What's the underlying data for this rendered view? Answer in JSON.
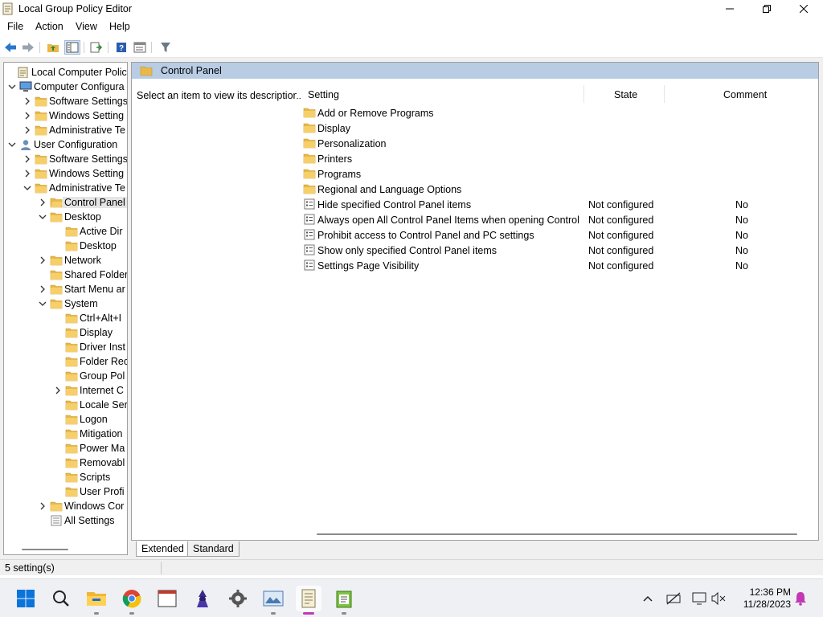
{
  "window": {
    "title": "Local Group Policy Editor",
    "controls": {
      "minimize": "—",
      "maximize": "❐",
      "close": "✕"
    }
  },
  "menu": [
    "File",
    "Action",
    "View",
    "Help"
  ],
  "toolbar": [
    "back-icon",
    "forward-icon",
    "up-folder-icon",
    "show-hide-tree-icon",
    "export-list-icon",
    "help-icon",
    "properties-icon",
    "filter-icon"
  ],
  "tree": [
    {
      "label": "Local Computer Policy",
      "icon": "computer-policy-icon",
      "level": 0,
      "expander": "none"
    },
    {
      "label": "Computer Configura",
      "icon": "computer-icon",
      "level": 1,
      "expander": "expanded"
    },
    {
      "label": "Software Settings",
      "icon": "folder-icon",
      "level": 2,
      "expander": "collapsed"
    },
    {
      "label": "Windows Setting",
      "icon": "folder-icon",
      "level": 2,
      "expander": "collapsed"
    },
    {
      "label": "Administrative Te",
      "icon": "folder-icon",
      "level": 2,
      "expander": "collapsed"
    },
    {
      "label": "User Configuration",
      "icon": "user-icon",
      "level": 1,
      "expander": "expanded"
    },
    {
      "label": "Software Settings",
      "icon": "folder-icon",
      "level": 2,
      "expander": "collapsed"
    },
    {
      "label": "Windows Setting",
      "icon": "folder-icon",
      "level": 2,
      "expander": "collapsed"
    },
    {
      "label": "Administrative Te",
      "icon": "folder-icon",
      "level": 2,
      "expander": "expanded"
    },
    {
      "label": "Control Panel",
      "icon": "folder-open-icon",
      "level": 3,
      "expander": "collapsed",
      "selected": true
    },
    {
      "label": "Desktop",
      "icon": "folder-icon",
      "level": 3,
      "expander": "expanded"
    },
    {
      "label": "Active Dir",
      "icon": "folder-icon",
      "level": 4,
      "expander": "none"
    },
    {
      "label": "Desktop",
      "icon": "folder-icon",
      "level": 4,
      "expander": "none"
    },
    {
      "label": "Network",
      "icon": "folder-icon",
      "level": 3,
      "expander": "collapsed"
    },
    {
      "label": "Shared Folder",
      "icon": "folder-icon",
      "level": 3,
      "expander": "none"
    },
    {
      "label": "Start Menu ar",
      "icon": "folder-icon",
      "level": 3,
      "expander": "collapsed"
    },
    {
      "label": "System",
      "icon": "folder-icon",
      "level": 3,
      "expander": "expanded"
    },
    {
      "label": "Ctrl+Alt+I",
      "icon": "folder-icon",
      "level": 4,
      "expander": "none"
    },
    {
      "label": "Display",
      "icon": "folder-icon",
      "level": 4,
      "expander": "none"
    },
    {
      "label": "Driver Inst",
      "icon": "folder-icon",
      "level": 4,
      "expander": "none"
    },
    {
      "label": "Folder Rec",
      "icon": "folder-icon",
      "level": 4,
      "expander": "none"
    },
    {
      "label": "Group Pol",
      "icon": "folder-icon",
      "level": 4,
      "expander": "none"
    },
    {
      "label": "Internet C",
      "icon": "folder-icon",
      "level": 4,
      "expander": "collapsed"
    },
    {
      "label": "Locale Ser",
      "icon": "folder-icon",
      "level": 4,
      "expander": "none"
    },
    {
      "label": "Logon",
      "icon": "folder-icon",
      "level": 4,
      "expander": "none"
    },
    {
      "label": "Mitigation",
      "icon": "folder-icon",
      "level": 4,
      "expander": "none"
    },
    {
      "label": "Power Ma",
      "icon": "folder-icon",
      "level": 4,
      "expander": "none"
    },
    {
      "label": "Removabl",
      "icon": "folder-icon",
      "level": 4,
      "expander": "none"
    },
    {
      "label": "Scripts",
      "icon": "folder-icon",
      "level": 4,
      "expander": "none"
    },
    {
      "label": "User Profi",
      "icon": "folder-icon",
      "level": 4,
      "expander": "none"
    },
    {
      "label": "Windows Cor",
      "icon": "folder-icon",
      "level": 3,
      "expander": "collapsed"
    },
    {
      "label": "All Settings",
      "icon": "all-settings-icon",
      "level": 3,
      "expander": "none"
    }
  ],
  "details": {
    "header": "Control Panel",
    "description": "Select an item to view its description.",
    "columns": {
      "setting": "Setting",
      "state": "State",
      "comment": "Comment"
    },
    "rows": [
      {
        "name": "Add or Remove Programs",
        "icon": "folder-icon",
        "state": "",
        "comment": ""
      },
      {
        "name": "Display",
        "icon": "folder-icon",
        "state": "",
        "comment": ""
      },
      {
        "name": "Personalization",
        "icon": "folder-icon",
        "state": "",
        "comment": ""
      },
      {
        "name": "Printers",
        "icon": "folder-icon",
        "state": "",
        "comment": ""
      },
      {
        "name": "Programs",
        "icon": "folder-icon",
        "state": "",
        "comment": ""
      },
      {
        "name": "Regional and Language Options",
        "icon": "folder-icon",
        "state": "",
        "comment": ""
      },
      {
        "name": "Hide specified Control Panel items",
        "icon": "policy-setting-icon",
        "state": "Not configured",
        "comment": "No"
      },
      {
        "name": "Always open All Control Panel Items when opening Control ...",
        "icon": "policy-setting-icon",
        "state": "Not configured",
        "comment": "No"
      },
      {
        "name": "Prohibit access to Control Panel and PC settings",
        "icon": "policy-setting-icon",
        "state": "Not configured",
        "comment": "No"
      },
      {
        "name": "Show only specified Control Panel items",
        "icon": "policy-setting-icon",
        "state": "Not configured",
        "comment": "No"
      },
      {
        "name": "Settings Page Visibility",
        "icon": "policy-setting-icon",
        "state": "Not configured",
        "comment": "No"
      }
    ]
  },
  "tabs": [
    {
      "label": "Extended",
      "active": true
    },
    {
      "label": "Standard",
      "active": false
    }
  ],
  "status": "5 setting(s)",
  "taskbar": {
    "apps": [
      "start-icon",
      "search-icon",
      "file-explorer-icon",
      "chrome-icon",
      "terminal-icon",
      "wizard-app-icon",
      "settings-gear-app-icon",
      "image-viewer-icon",
      "group-policy-icon",
      "notepad-icon"
    ],
    "active_app": "group-policy-icon",
    "time": "12:36 PM",
    "date": "11/28/2023"
  },
  "colors": {
    "header_bar": "#b8cce4",
    "folder": "#e8b84a",
    "accent": "#0067c0",
    "active_pip": "#c239b3"
  }
}
